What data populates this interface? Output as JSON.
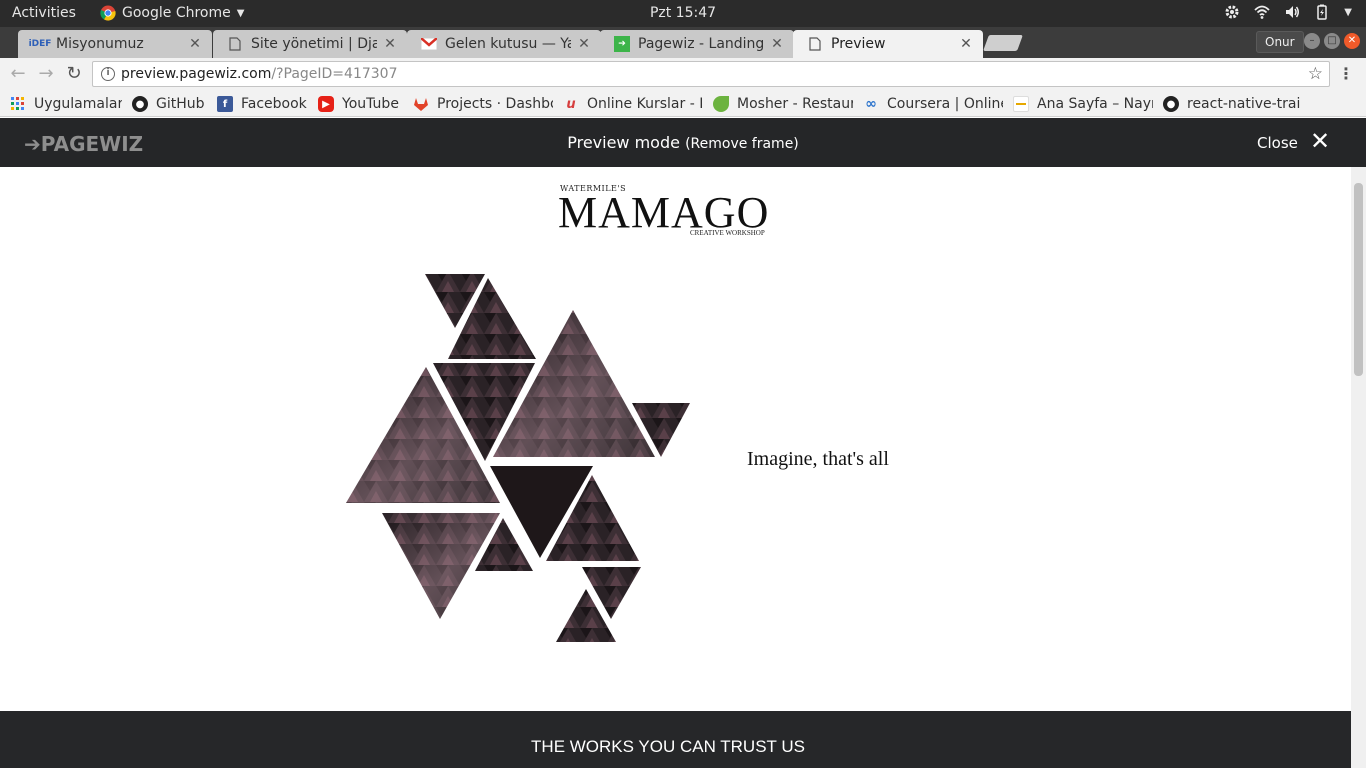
{
  "system": {
    "activities": "Activities",
    "app_name": "Google Chrome",
    "clock": "Pzt 15:47"
  },
  "tabs": [
    {
      "title": "Misyonumuz",
      "favicon": "idef-icon",
      "active": false
    },
    {
      "title": "Site yönetimi | Djan",
      "favicon": "page-icon",
      "active": false
    },
    {
      "title": "Gelen kutusu — Yar",
      "favicon": "gmail-icon",
      "active": false
    },
    {
      "title": "Pagewiz - Landing P",
      "favicon": "pagewiz-icon",
      "active": false
    },
    {
      "title": "Preview",
      "favicon": "page-icon",
      "active": true
    }
  ],
  "profile": "Onur",
  "omnibox": {
    "host": "preview.pagewiz.com",
    "path": "/?PageID=417307"
  },
  "bookmarks": [
    {
      "label": "Uygulamalar",
      "icon": "apps-grid-icon"
    },
    {
      "label": "GitHub",
      "icon": "github-icon"
    },
    {
      "label": "Facebook",
      "icon": "facebook-icon"
    },
    {
      "label": "YouTube",
      "icon": "youtube-icon"
    },
    {
      "label": "Projects · Dashbo",
      "icon": "gitlab-icon"
    },
    {
      "label": "Online Kurslar - I",
      "icon": "udemy-icon"
    },
    {
      "label": "Mosher - Restaur",
      "icon": "leaf-icon"
    },
    {
      "label": "Coursera | Online",
      "icon": "coursera-icon"
    },
    {
      "label": "Ana Sayfa – Nayn",
      "icon": "nayn-icon"
    },
    {
      "label": "react-native-trai",
      "icon": "github-icon"
    }
  ],
  "preview_bar": {
    "logo": "PAGEWIZ",
    "mode": "Preview mode",
    "remove_frame": "(Remove frame)",
    "close": "Close"
  },
  "page": {
    "logo_small": "WATERMILE'S",
    "logo_main": "MAMAGO",
    "logo_sub": "CREATIVE WORKSHOP",
    "tagline": "Imagine, that's all",
    "section_title": "THE WORKS YOU CAN TRUST US"
  }
}
